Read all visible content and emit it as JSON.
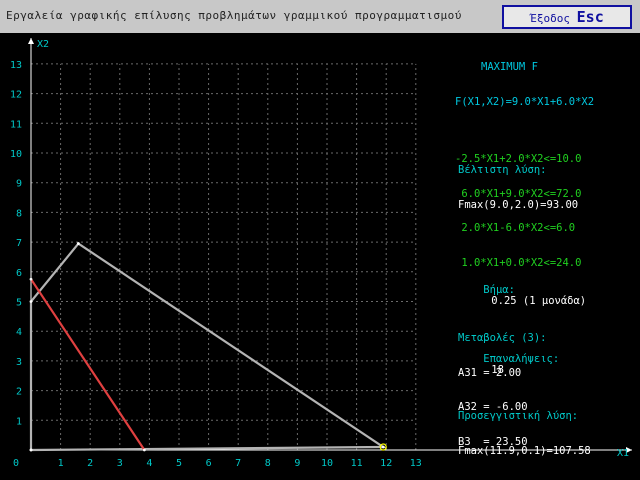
{
  "window": {
    "title": "Εργαλεία γραφικής επίλυσης προβλημάτων γραμμικού προγραμματισμού",
    "button_label": "Έξοδος",
    "button_glyph": "Esc"
  },
  "colors": {
    "background": "#000000",
    "grid": "#6a6a6a",
    "axis": "#ffffff",
    "feasible_region": "#b4b4b4",
    "objective_line": "#e04040",
    "header_text": "#00c8e0",
    "constraint_text": "#20d020",
    "label_text": "#00c8c8",
    "value_text": "#ffffff"
  },
  "panel": {
    "header": "MAXIMUM F",
    "objective": "F(X1,X2)=9.0*X1+6.0*X2",
    "constraints": [
      "-2.5*X1+2.0*X2<=10.0",
      " 6.0*X1+9.0*X2<=72.0",
      " 2.0*X1-6.0*X2<=6.0",
      " 1.0*X1+0.0*X2<=24.0"
    ],
    "optimal_label": "Βέλτιστη λύση:",
    "optimal_value": "Fmax(9.0,2.0)=93.00",
    "step_label": "Βήμα:",
    "step_value": "0.25 (1 μονάδα)",
    "iter_label": "Επαναλήψεις:",
    "iter_value": "18",
    "approx_label": "Προσεγγιστική λύση:",
    "approx_value": "Fmax(11.9,0.1)=107.58",
    "changes_label": "Μεταβολές (3):",
    "changes": [
      "A31 = 2.00",
      "A32 = -6.00",
      "B3  = 23.50"
    ]
  },
  "chart_data": {
    "type": "line",
    "title": "",
    "xlabel": "X1",
    "ylabel": "X2",
    "xlim": [
      0,
      13
    ],
    "ylim": [
      0,
      13
    ],
    "x_ticks": [
      0,
      1,
      2,
      3,
      4,
      5,
      6,
      7,
      8,
      9,
      10,
      11,
      12,
      13
    ],
    "y_ticks": [
      1,
      2,
      3,
      4,
      5,
      6,
      7,
      8,
      9,
      10,
      11,
      12,
      13
    ],
    "grid": true,
    "series": [
      {
        "key": "feasible_region",
        "x": [
          0,
          0,
          1.6,
          11.9,
          0
        ],
        "y": [
          0,
          5.0,
          6.95,
          0.1,
          0
        ]
      },
      {
        "key": "objective_line",
        "x": [
          0,
          3.83
        ],
        "y": [
          5.75,
          0
        ]
      }
    ],
    "markers": [
      {
        "x": 11.9,
        "y": 0.1
      }
    ]
  }
}
